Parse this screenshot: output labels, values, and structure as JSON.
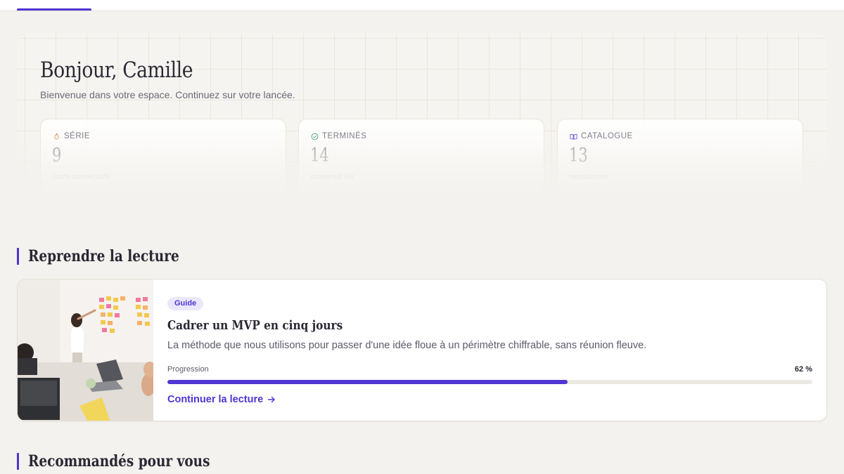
{
  "greeting": {
    "title": "Bonjour, Camille",
    "subtitle": "Bienvenue dans votre espace. Continuez sur votre lancée."
  },
  "stats": [
    {
      "icon": "flame-icon",
      "label": "SÉRIE",
      "value": "9",
      "caption": "jours consécutifs",
      "color": "#e08a4a"
    },
    {
      "icon": "check-circle-icon",
      "label": "TERMINÉS",
      "value": "14",
      "caption": "contenus lus",
      "color": "#3a9a6a"
    },
    {
      "icon": "book-open-icon",
      "label": "CATALOGUE",
      "value": "13",
      "caption": "ressources",
      "color": "#4f35d2"
    }
  ],
  "sections": {
    "resume": "Reprendre la lecture",
    "recommended": "Recommandés pour vous"
  },
  "resume_card": {
    "badge": "Guide",
    "title": "Cadrer un MVP en cinq jours",
    "description": "La méthode que nous utilisons pour passer d'une idée floue à un périmètre chiffrable, sans réunion fleuve.",
    "progress_label": "Progression",
    "progress_text": "62 %",
    "progress": 0.62,
    "cta": "Continuer la lecture",
    "cta_icon": "arrow-right-icon"
  },
  "colors": {
    "accent": "#4f35d2",
    "background": "#f4f2ee"
  }
}
